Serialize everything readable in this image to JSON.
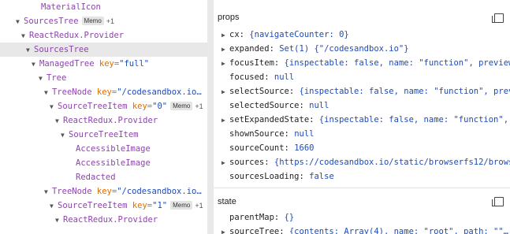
{
  "tree": [
    {
      "name": "MaterialIcon",
      "indent": 42,
      "arrow": ""
    },
    {
      "name": "SourcesTree",
      "indent": 20,
      "arrow": "▼",
      "badge": "Memo",
      "plus": "+1"
    },
    {
      "name": "ReactRedux.Provider",
      "indent": 27,
      "arrow": "▼"
    },
    {
      "name": "SourcesTree",
      "indent": 33,
      "arrow": "▼",
      "selected": true
    },
    {
      "name": "ManagedTree",
      "indent": 40,
      "arrow": "▼",
      "key": "full"
    },
    {
      "name": "Tree",
      "indent": 49,
      "arrow": "▼"
    },
    {
      "name": "TreeNode",
      "indent": 56,
      "arrow": "▼",
      "key": "/codesandbox.io…",
      "trunc": true
    },
    {
      "name": "SourceTreeItem",
      "indent": 63,
      "arrow": "▼",
      "key": "0",
      "badge": "Memo",
      "plus": "+1"
    },
    {
      "name": "ReactRedux.Provider",
      "indent": 70,
      "arrow": "▼"
    },
    {
      "name": "SourceTreeItem",
      "indent": 77,
      "arrow": "▼"
    },
    {
      "name": "AccessibleImage",
      "indent": 86,
      "arrow": ""
    },
    {
      "name": "AccessibleImage",
      "indent": 86,
      "arrow": ""
    },
    {
      "name": "Redacted",
      "indent": 86,
      "arrow": ""
    },
    {
      "name": "TreeNode",
      "indent": 56,
      "arrow": "▼",
      "key": "/codesandbox.io…",
      "trunc": true
    },
    {
      "name": "SourceTreeItem",
      "indent": 63,
      "arrow": "▼",
      "key": "1",
      "badge": "Memo",
      "plus": "+1"
    },
    {
      "name": "ReactRedux.Provider",
      "indent": 70,
      "arrow": "▼"
    }
  ],
  "props": {
    "title": "props",
    "items": [
      {
        "key": "cx",
        "value": "{navigateCounter: 0}",
        "arrow": "▶"
      },
      {
        "key": "expanded",
        "value": "Set(1) {\"/codesandbox.io\"}",
        "arrow": "▶"
      },
      {
        "key": "focusItem",
        "value": "{inspectable: false, name: \"function\", preview…",
        "arrow": "▶"
      },
      {
        "key": "focused",
        "value": "null",
        "arrow": ""
      },
      {
        "key": "selectSource",
        "value": "{inspectable: false, name: \"function\", prev…",
        "arrow": "▶"
      },
      {
        "key": "selectedSource",
        "value": "null",
        "arrow": ""
      },
      {
        "key": "setExpandedState",
        "value": "{inspectable: false, name: \"function\", …",
        "arrow": "▶"
      },
      {
        "key": "shownSource",
        "value": "null",
        "arrow": ""
      },
      {
        "key": "sourceCount",
        "value": "1660",
        "arrow": ""
      },
      {
        "key": "sources",
        "value": "{https://codesandbox.io/static/browserfs12/brows…",
        "arrow": "▶"
      },
      {
        "key": "sourcesLoading",
        "value": "false",
        "arrow": ""
      }
    ]
  },
  "state": {
    "title": "state",
    "items": [
      {
        "key": "parentMap",
        "value": "{}",
        "arrow": ""
      },
      {
        "key": "sourceTree",
        "value": "{contents: Array(4), name: \"root\", path: \"\"…",
        "arrow": "▶"
      }
    ]
  }
}
